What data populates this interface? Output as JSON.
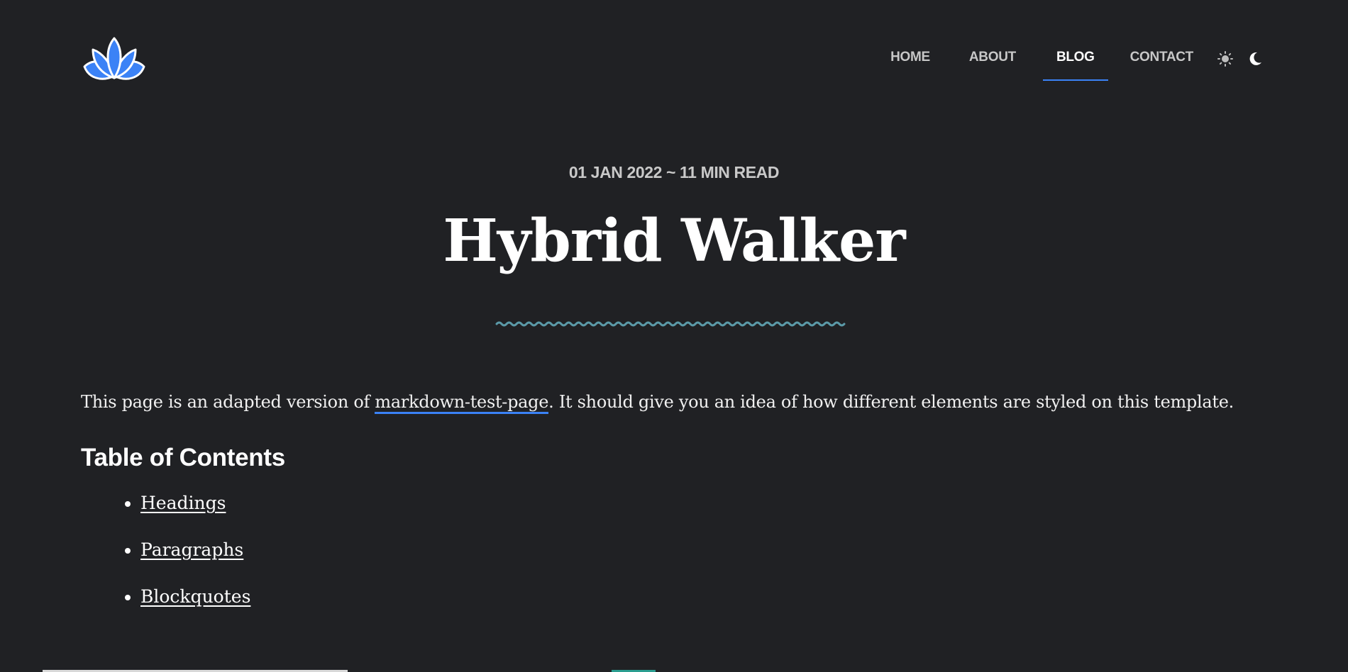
{
  "header": {
    "logo_icon": "lotus-icon",
    "nav": [
      {
        "label": "HOME",
        "active": false
      },
      {
        "label": "ABOUT",
        "active": false
      },
      {
        "label": "BLOG",
        "active": true
      },
      {
        "label": "CONTACT",
        "active": false
      }
    ],
    "theme_icons": [
      "sun-icon",
      "moon-icon"
    ]
  },
  "post": {
    "meta": "01 JAN 2022 ~ 11 MIN READ",
    "title": "Hybrid Walker",
    "intro_before": "This page is an adapted version of ",
    "intro_link": "markdown-test-page",
    "intro_after": ". It should give you an idea of how different elements are styled on this template.",
    "toc_heading": "Table of Contents",
    "toc_items": [
      "Headings",
      "Paragraphs",
      "Blockquotes"
    ]
  },
  "colors": {
    "background": "#202124",
    "accent": "#3b82f6",
    "squiggle": "#5b9aa8"
  }
}
